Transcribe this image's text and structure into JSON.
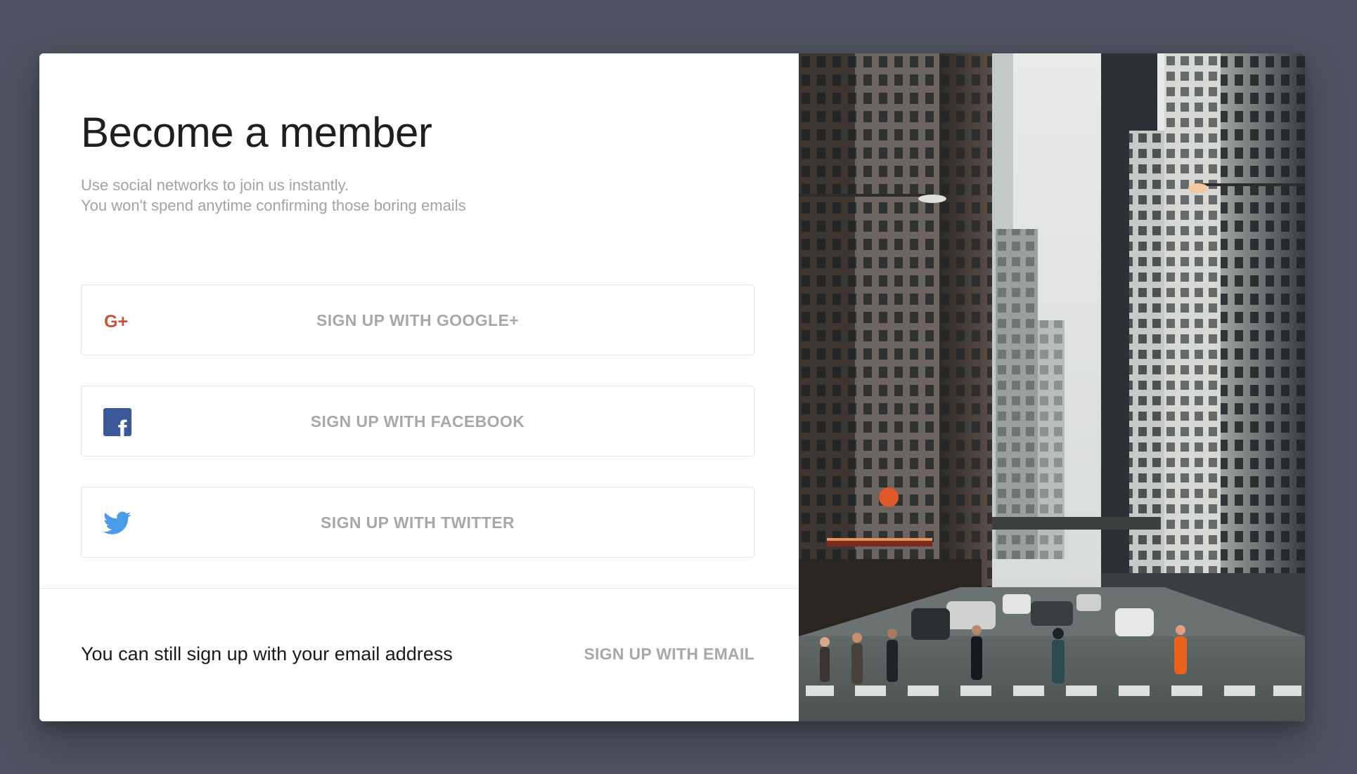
{
  "page": {
    "title": "Become a member",
    "subtitle_lines": [
      "Use social networks to join us instantly.",
      "You won't spend anytime confirming those boring emails"
    ]
  },
  "social_buttons": [
    {
      "label": "SIGN UP WITH GOOGLE+",
      "icon": "google-plus-icon",
      "icon_text": "G+",
      "icon_color": "#c8543b"
    },
    {
      "label": "SIGN UP WITH FACEBOOK",
      "icon": "facebook-icon",
      "icon_text": "f",
      "icon_color": "#3b5998"
    },
    {
      "label": "SIGN UP WITH TWITTER",
      "icon": "twitter-icon",
      "icon_color": "#4c9be8"
    }
  ],
  "email_section": {
    "text": "You can still sign up with your email address",
    "link_label": "SIGN UP WITH EMAIL"
  },
  "hero_image": {
    "subject": "city-street-photo"
  },
  "colors": {
    "background": "#4f5361",
    "card": "#ffffff",
    "muted_text": "#a8a8a8",
    "title_text": "#1f1f1f"
  }
}
